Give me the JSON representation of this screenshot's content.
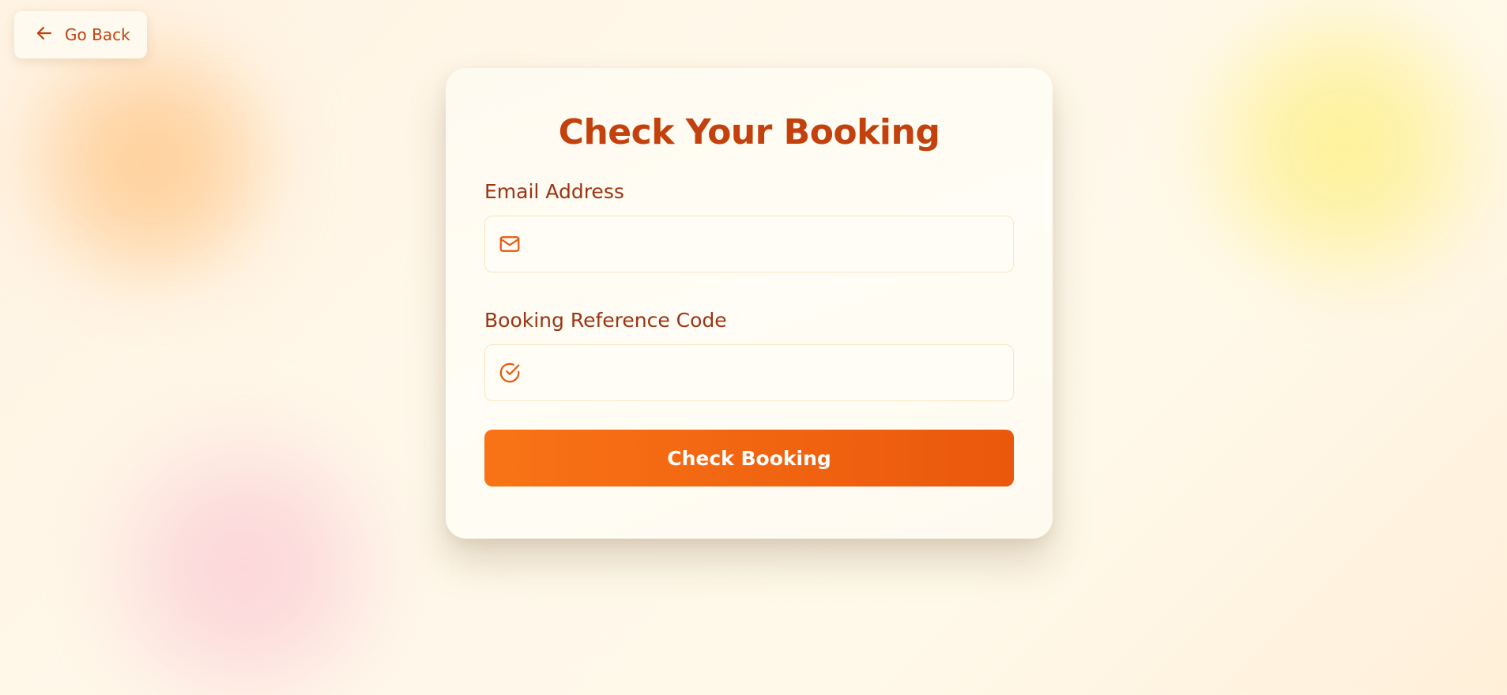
{
  "navigation": {
    "back_label": "Go Back",
    "back_icon": "arrow-left-icon"
  },
  "form": {
    "title": "Check Your Booking",
    "email": {
      "label": "Email Address",
      "value": "",
      "placeholder": "",
      "icon": "mail-icon"
    },
    "reference": {
      "label": "Booking Reference Code",
      "value": "",
      "placeholder": "",
      "icon": "check-circle-icon"
    },
    "submit_label": "Check Booking"
  },
  "colors": {
    "accent": "#c2410c",
    "label": "#9a3412",
    "button_start": "#f97316",
    "button_end": "#ea580c",
    "input_border": "#fde4bf",
    "blob_orange": "#ffc482",
    "blob_yellow": "#fef08a",
    "blob_pink": "#fbcfd4"
  }
}
